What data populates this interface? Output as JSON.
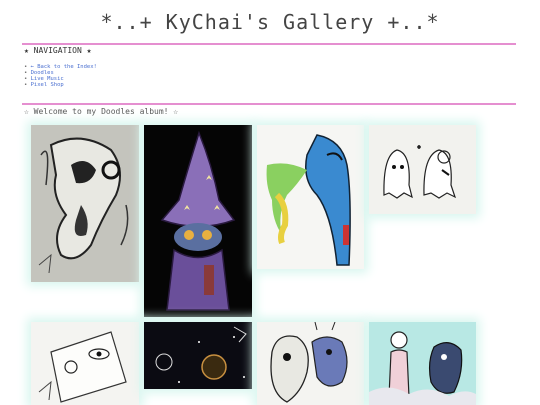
{
  "page": {
    "title": "*..+ KyChai's Gallery +..*"
  },
  "navigation": {
    "heading": "★ NAVIGATION ★",
    "items": [
      {
        "label": "← Back to the Index!"
      },
      {
        "label": "Doodles"
      },
      {
        "label": "Live Music"
      },
      {
        "label": "Pixel Shop"
      }
    ]
  },
  "album": {
    "heading": "☆ Welcome to my Doodles album! ☆"
  },
  "colors": {
    "divider": "#e58fd0",
    "link": "#4a6fd0",
    "glow": "#d8f6ef"
  },
  "gallery": {
    "images": [
      {
        "name": "creature-sketch"
      },
      {
        "name": "wizard-drawing"
      },
      {
        "name": "blue-creature-drawing"
      },
      {
        "name": "ghosts-sketch"
      },
      {
        "name": "face-sketch"
      },
      {
        "name": "space-drawing"
      },
      {
        "name": "monster-sketch"
      },
      {
        "name": "characters-drawing"
      }
    ]
  }
}
